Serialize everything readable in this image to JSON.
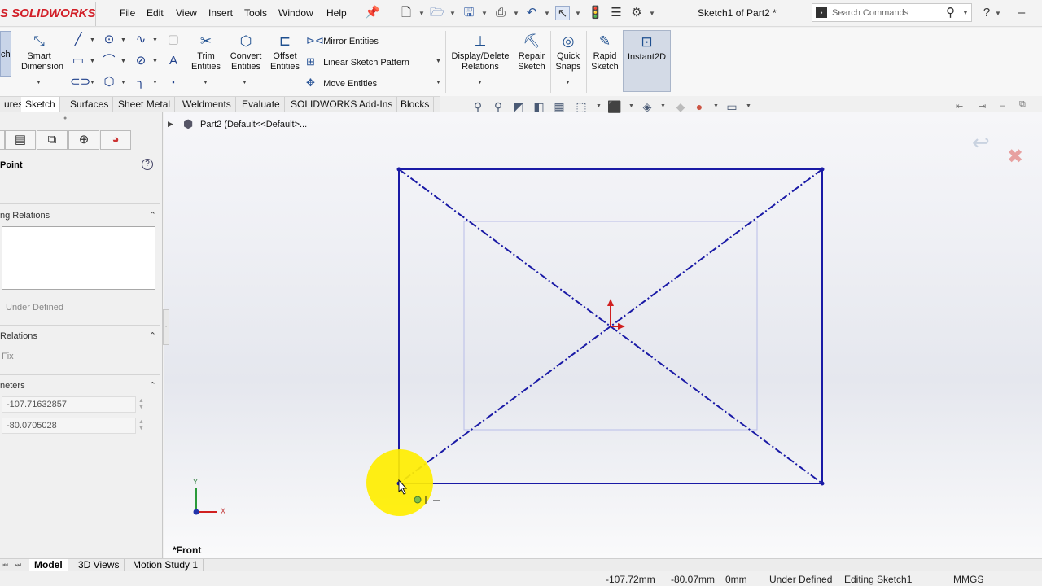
{
  "app": {
    "logo_text": "SOLIDWORKS",
    "doc_title": "Sketch1 of Part2 *"
  },
  "menu": [
    "File",
    "Edit",
    "View",
    "Insert",
    "Tools",
    "Window",
    "Help"
  ],
  "search": {
    "placeholder": "Search Commands"
  },
  "ribbon": {
    "sketch_partial": "ch",
    "smart_dimension": "Smart Dimension",
    "trim": "Trim Entities",
    "convert": "Convert Entities",
    "offset": "Offset Entities",
    "mirror": "Mirror Entities",
    "linear_pattern": "Linear Sketch Pattern",
    "move": "Move Entities",
    "display_delete": "Display/Delete Relations",
    "repair": "Repair Sketch",
    "quick_snaps": "Quick Snaps",
    "rapid_sketch": "Rapid Sketch",
    "instant2d": "Instant2D"
  },
  "tabs": [
    "ures",
    "Sketch",
    "Surfaces",
    "Sheet Metal",
    "Weldments",
    "Evaluate",
    "SOLIDWORKS Add-Ins",
    "Blocks"
  ],
  "active_tab": "Sketch",
  "tree": {
    "part_label": "Part2  (Default<<Default>..."
  },
  "panel": {
    "title": "Point",
    "existing_relations": "ng Relations",
    "status": "Under Defined",
    "add_relations": "Relations",
    "add_fix": "Fix",
    "parameters": "neters",
    "x_value": "-107.71632857",
    "y_value": "-80.0705028"
  },
  "view_label": "*Front",
  "triad": {
    "x": "X",
    "y": "Y"
  },
  "bottom_tabs": [
    "Model",
    "3D Views",
    "Motion Study 1"
  ],
  "status": {
    "x": "-107.72mm",
    "y": "-80.07mm",
    "z": "0mm",
    "definition": "Under Defined",
    "editing": "Editing Sketch1",
    "units": "MMGS"
  },
  "colors": {
    "sketch": "#1a1aa6",
    "accent": "#1e4f8f",
    "highlight": "#ffee00"
  }
}
